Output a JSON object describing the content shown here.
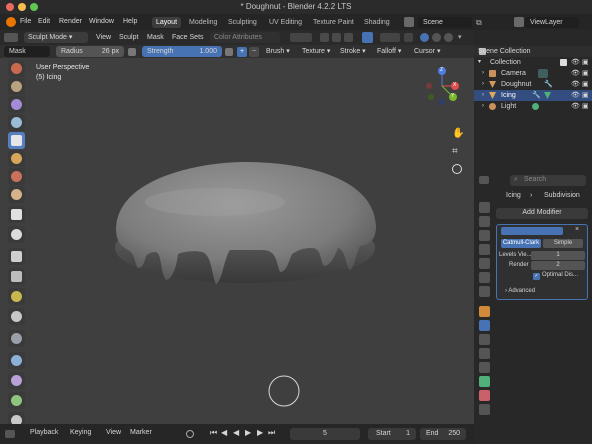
{
  "window": {
    "title": "* Doughnut - Blender 4.2.2 LTS"
  },
  "menu": {
    "items": [
      "File",
      "Edit",
      "Render",
      "Window",
      "Help"
    ]
  },
  "workspaces": {
    "tabs": [
      "Layout",
      "Modeling",
      "Sculpting",
      "UV Editing",
      "Texture Paint",
      "Shading"
    ],
    "active": "Layout"
  },
  "scene": {
    "label": "Scene",
    "viewlayer": "ViewLayer"
  },
  "header2": {
    "mode": "Sculpt Mode",
    "items": [
      "View",
      "Sculpt",
      "Mask",
      "Face Sets"
    ],
    "color_attr": "Color Attributes"
  },
  "toolsettings": {
    "brush_name": "Mask",
    "radius_label": "Radius",
    "radius_value": "26 px",
    "strength_label": "Strength",
    "strength_value": "1.000",
    "items": [
      "Brush",
      "Texture",
      "Stroke",
      "Falloff",
      "Cursor"
    ]
  },
  "viewport": {
    "perspective": "User Perspective",
    "object": "(5) Icing",
    "gizmo": {
      "x": "X",
      "y": "Y",
      "z": "Z"
    }
  },
  "timeline": {
    "items": [
      "Playback",
      "Keying",
      "View",
      "Marker"
    ],
    "current_frame": "5",
    "start_label": "Start",
    "start_value": "1",
    "end_label": "End",
    "end_value": "250"
  },
  "outliner": {
    "header": "Scene Collection",
    "collection": "Collection",
    "objects": [
      "Camera",
      "Doughnut",
      "Icing",
      "Light"
    ],
    "selected": "Icing"
  },
  "properties": {
    "search_placeholder": "Search",
    "breadcrumb_obj": "Icing",
    "breadcrumb_mod": "Subdivision",
    "add_modifier": "Add Modifier",
    "modifier_tabs": [
      "Catmull-Clark",
      "Simple"
    ],
    "levels_label": "Levels Vie...",
    "levels_value": "1",
    "render_label": "Render",
    "render_value": "2",
    "optimal_label": "Optimal Dis...",
    "advanced_label": "Advanced"
  },
  "colors": {
    "accent": "#4772b3",
    "active_tool": "#5680c2",
    "viewport_bg": "#3f3f3f",
    "x_axis": "#e04e4e",
    "y_axis": "#7ab82e",
    "z_axis": "#4f7ee0"
  }
}
